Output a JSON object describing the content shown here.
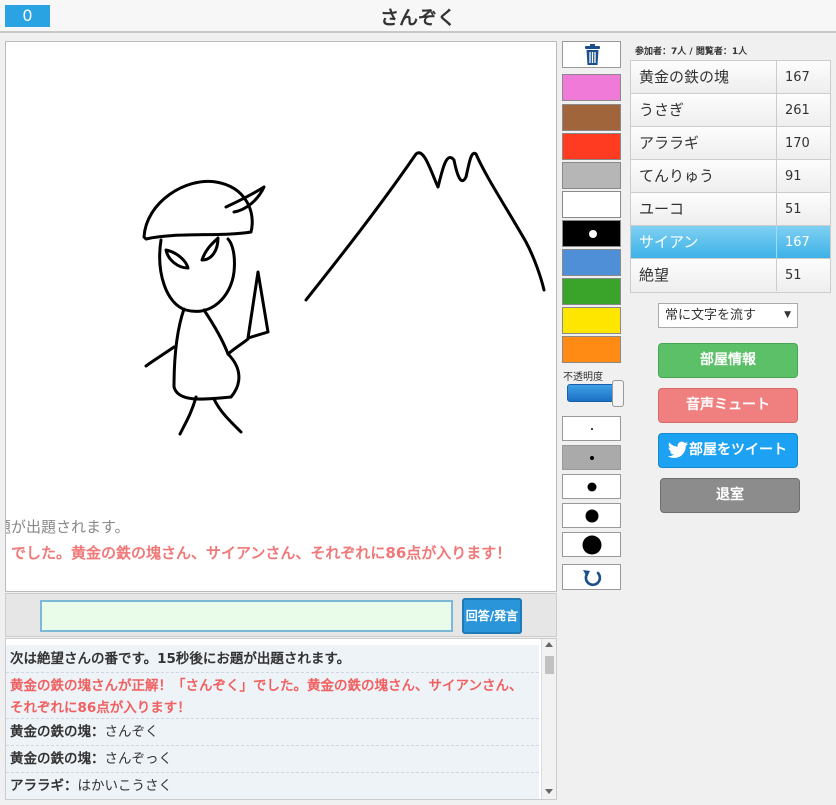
{
  "header": {
    "timer": "0",
    "title": "さんぞく"
  },
  "canvas_overlay": {
    "line1": "題が出題されます。",
    "line2": "」でした。黄金の鉄の塊さん、サイアンさん、それぞれに86点が入ります！"
  },
  "answer": {
    "input_value": "",
    "button_label": "回答/発言"
  },
  "chat": [
    {
      "type": "system",
      "text": "次は絶望さんの番です。15秒後にお題が出題されます。"
    },
    {
      "type": "correct",
      "text": "黄金の鉄の塊さんが正解！「さんぞく」でした。黄金の鉄の塊さん、サイアンさん、それぞれに86点が入ります！"
    },
    {
      "type": "message",
      "speaker": "黄金の鉄の塊：",
      "text": "さんぞく"
    },
    {
      "type": "message",
      "speaker": "黄金の鉄の塊：",
      "text": "さんぞっく"
    },
    {
      "type": "message",
      "speaker": "アララギ：",
      "text": "はかいこうさく"
    }
  ],
  "tools": {
    "trash_icon": "trash-icon",
    "colors": [
      "#f07ad8",
      "#a0653a",
      "#ff3b22",
      "#b6b6b6",
      "#ffffff",
      "#000000",
      "#4f8fd8",
      "#3aa32a",
      "#ffe600",
      "#ff8a14"
    ],
    "opacity_label": "不透明度",
    "opacity_value": 1.0,
    "brush_sizes": [
      2,
      4,
      9,
      13,
      19
    ],
    "undo_icon": "undo-icon"
  },
  "sidebar": {
    "participants": "参加者：7人 / 閲覧者：1人",
    "scores": [
      {
        "name": "黄金の鉄の塊",
        "points": "167",
        "active": false
      },
      {
        "name": "うさぎ",
        "points": "261",
        "active": false
      },
      {
        "name": "アララギ",
        "points": "170",
        "active": false
      },
      {
        "name": "てんりゅう",
        "points": "91",
        "active": false
      },
      {
        "name": "ユーコ",
        "points": "51",
        "active": false
      },
      {
        "name": "サイアン",
        "points": "167",
        "active": true
      },
      {
        "name": "絶望",
        "points": "51",
        "active": false
      }
    ],
    "scroll_select": "常に文字を流す",
    "buttons": {
      "room_info": "部屋情報",
      "mute": "音声ミュート",
      "tweet": "部屋をツイート",
      "exit": "退室"
    }
  }
}
